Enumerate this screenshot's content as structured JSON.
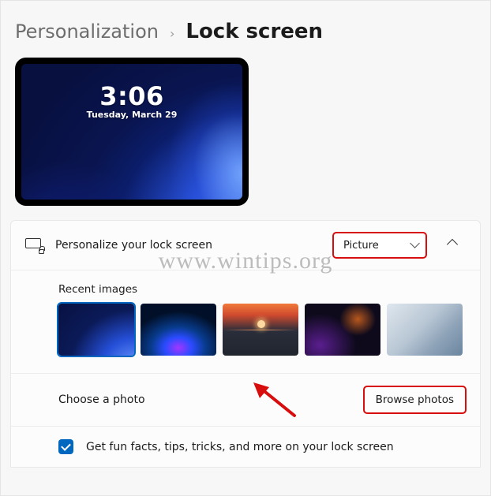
{
  "breadcrumb": {
    "parent": "Personalization",
    "separator": "›",
    "current": "Lock screen"
  },
  "preview": {
    "time": "3:06",
    "date": "Tuesday, March 29"
  },
  "personalize": {
    "label": "Personalize your lock screen",
    "selected": "Picture"
  },
  "recent": {
    "label": "Recent images"
  },
  "choose": {
    "label": "Choose a photo",
    "button": "Browse photos"
  },
  "fun": {
    "label": "Get fun facts, tips, tricks, and more on your lock screen",
    "checked": true
  },
  "watermark": "www.wintips.org"
}
